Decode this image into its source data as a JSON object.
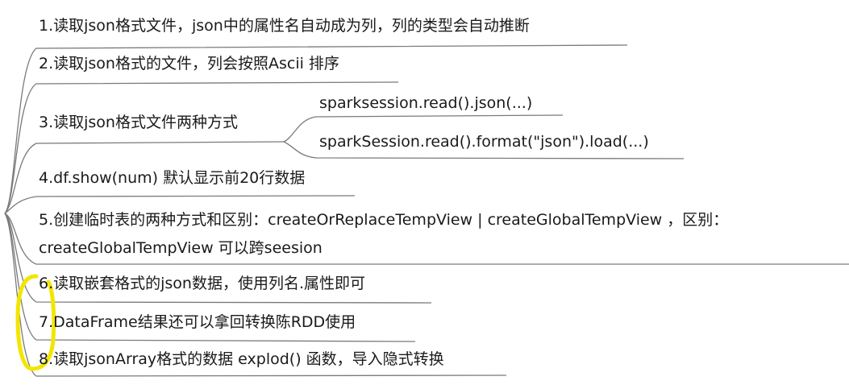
{
  "mindmap": {
    "nodes": [
      {
        "id": "n1",
        "text": "1.读取json格式文件，json中的属性名自动成为列，列的类型会自动推断"
      },
      {
        "id": "n2",
        "text": "2.读取json格式的文件，列会按照Ascii 排序"
      },
      {
        "id": "n3",
        "text": "3.读取json格式文件两种方式",
        "children": [
          {
            "id": "n3a",
            "text": "sparksession.read().json(...)"
          },
          {
            "id": "n3b",
            "text": "sparkSession.read().format(\"json\").load(...)"
          }
        ]
      },
      {
        "id": "n4",
        "text": "4.df.show(num) 默认显示前20行数据"
      },
      {
        "id": "n5",
        "lines": [
          "5.创建临时表的两种方式和区别：createOrReplaceTempView  | createGlobalTempView ，区别：",
          "createGlobalTempView 可以跨seesion"
        ]
      },
      {
        "id": "n6",
        "text": "6.读取嵌套格式的json数据，使用列名.属性即可"
      },
      {
        "id": "n7",
        "text": "7.DataFrame结果还可以拿回转换陈RDD使用"
      },
      {
        "id": "n8",
        "text": "8.读取jsonArray格式的数据 explod() 函数，导入隐式转换"
      }
    ],
    "colors": {
      "line": "#7a7a7a",
      "text": "#1a1a1a",
      "highlight": "#f2e600"
    }
  }
}
